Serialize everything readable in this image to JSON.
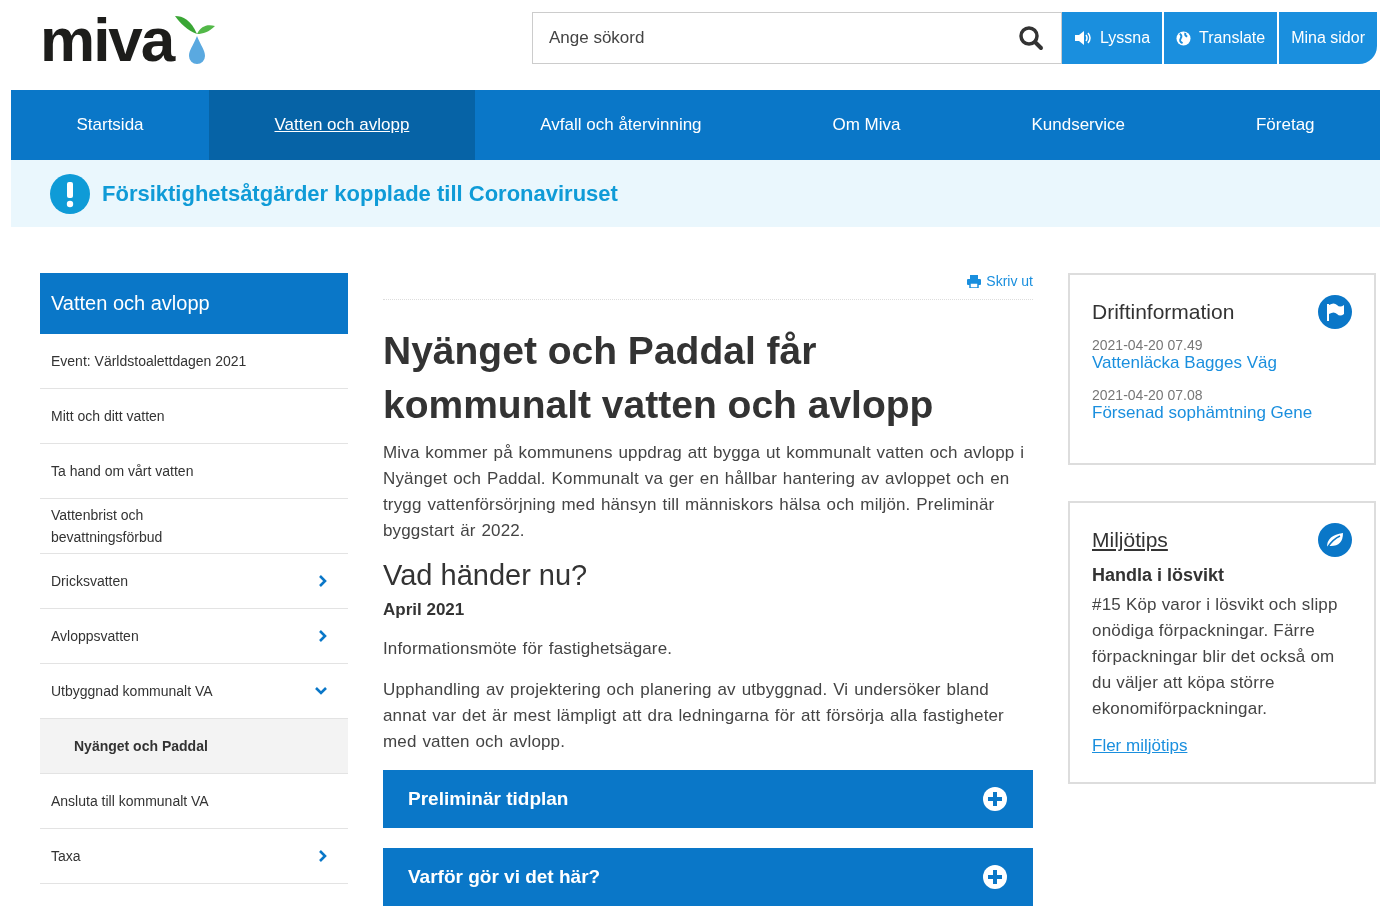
{
  "logo": {
    "text": "miva"
  },
  "search": {
    "placeholder": "Ange sökord"
  },
  "top_buttons": [
    {
      "kind": "listen",
      "label": "Lyssna"
    },
    {
      "kind": "translate",
      "label": "Translate"
    },
    {
      "kind": "plain",
      "label": "Mina sidor"
    }
  ],
  "nav": [
    {
      "label": "Startsida",
      "selected": false
    },
    {
      "label": "Vatten och avlopp",
      "selected": true
    },
    {
      "label": "Avfall och återvinning",
      "selected": false
    },
    {
      "label": "Om Miva",
      "selected": false
    },
    {
      "label": "Kundservice",
      "selected": false
    },
    {
      "label": "Företag",
      "selected": false
    }
  ],
  "alert": {
    "text": "Försiktighetsåtgärder kopplade till Coronaviruset"
  },
  "sidebar": {
    "title": "Vatten och avlopp",
    "items": [
      {
        "label": "Event: Världstoalettdagen 2021",
        "kind": "link",
        "selected": false
      },
      {
        "label": "Mitt och ditt vatten",
        "kind": "link",
        "selected": false
      },
      {
        "label": "Ta hand om vårt vatten",
        "kind": "link",
        "selected": false
      },
      {
        "label": "Vattenbrist och bevattningsförbud",
        "kind": "link",
        "selected": false
      },
      {
        "label": "Dricksvatten",
        "kind": "folder",
        "expanded": false,
        "selected": false
      },
      {
        "label": "Avloppsvatten",
        "kind": "folder",
        "expanded": false,
        "selected": false
      },
      {
        "label": "Utbyggnad kommunalt VA",
        "kind": "folder",
        "expanded": true,
        "selected": false,
        "children": [
          {
            "label": "Nyänget och Paddal",
            "selected": true
          }
        ]
      },
      {
        "label": "Ansluta till kommunalt VA",
        "kind": "link",
        "selected": false
      },
      {
        "label": "Taxa",
        "kind": "folder",
        "expanded": false,
        "selected": false
      }
    ]
  },
  "article": {
    "print_link": "Skriv ut",
    "title": "Nyänget och Paddal får kommunalt vatten och avlopp",
    "intro": "Miva kommer på kommunens uppdrag att bygga ut kommunalt vatten och avlopp i Nyänget och Paddal. Kommunalt va ger en hållbar hantering av avloppet och en trygg vattenförsörjning med hänsyn till människors hälsa och miljön. Preliminär byggstart är 2022.",
    "subheading": "Vad händer nu?",
    "date": "April 2021",
    "paragraphs": [
      "Informationsmöte för fastighetsägare.",
      "Upphandling av projektering och planering av utbyggnad. Vi undersöker bland annat var det är mest lämpligt att dra ledningarna för att försörja alla fastigheter med vatten och avlopp."
    ],
    "accordions": [
      {
        "label": "Preliminär tidplan",
        "expanded": false
      },
      {
        "label": "Varför gör vi det här?",
        "expanded": false
      }
    ]
  },
  "operations": {
    "title": "Driftinformation",
    "items": [
      {
        "time": "2021-04-20 07.49",
        "title": "Vattenläcka Bagges Väg"
      },
      {
        "time": "2021-04-20 07.08",
        "title": "Försenad sophämtning Gene"
      }
    ]
  },
  "eco_tips": {
    "title": "Miljötips",
    "heading": "Handla i lösvikt",
    "text": "#15 Köp varor i lösvikt och slipp onödiga förpackningar. Färre förpackningar blir det också om du väljer att köpa större ekonomiförpackningar.",
    "link": "Fler miljötips"
  }
}
